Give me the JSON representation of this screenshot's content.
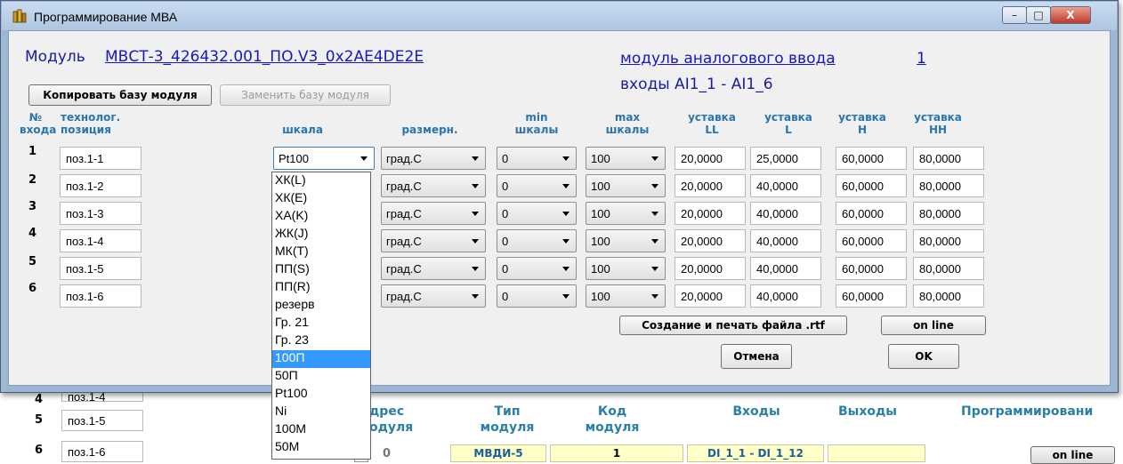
{
  "window": {
    "title": "Программирование МВА",
    "minimize": "–",
    "maximize": "□",
    "close": "X"
  },
  "module": {
    "prefix": "Модуль",
    "name_link": "МВСТ-3_426432.001_ПО.V3_0x2AE4DE2E",
    "type_link": "модуль аналогового ввода",
    "number_link": "1",
    "inputs_label": "входы AI1_1 - AI1_6"
  },
  "buttons": {
    "copy": "Копировать базу модуля",
    "replace": "Заменить базу модуля",
    "create_print": "Создание и печать файла .rtf",
    "online": "on line",
    "cancel": "Отмена",
    "ok": "OK"
  },
  "columns": {
    "num_1": "№",
    "num_2": "входа",
    "pos_1": "технолог.",
    "pos_2": "позиция",
    "scale": "шкала",
    "unit": "размерн.",
    "min_1": "min",
    "min_2": "шкалы",
    "max_1": "max",
    "max_2": "шкалы",
    "ll_1": "уставка",
    "ll_2": "LL",
    "l_1": "уставка",
    "l_2": "L",
    "h_1": "уставка",
    "h_2": "H",
    "hh_1": "уставка",
    "hh_2": "HH"
  },
  "rows": [
    {
      "num": "1",
      "pos": "поз.1-1",
      "scale": "Pt100",
      "unit": "град.С",
      "min": "0",
      "max": "100",
      "ll": "20,0000",
      "l": "25,0000",
      "h": "60,0000",
      "hh": "80,0000"
    },
    {
      "num": "2",
      "pos": "поз.1-2",
      "unit": "град.С",
      "min": "0",
      "max": "100",
      "ll": "20,0000",
      "l": "40,0000",
      "h": "60,0000",
      "hh": "80,0000"
    },
    {
      "num": "3",
      "pos": "поз.1-3",
      "unit": "град.С",
      "min": "0",
      "max": "100",
      "ll": "20,0000",
      "l": "40,0000",
      "h": "60,0000",
      "hh": "80,0000"
    },
    {
      "num": "4",
      "pos": "поз.1-4",
      "unit": "град.С",
      "min": "0",
      "max": "100",
      "ll": "20,0000",
      "l": "40,0000",
      "h": "60,0000",
      "hh": "80,0000"
    },
    {
      "num": "5",
      "pos": "поз.1-5",
      "unit": "град.С",
      "min": "0",
      "max": "100",
      "ll": "20,0000",
      "l": "40,0000",
      "h": "60,0000",
      "hh": "80,0000"
    },
    {
      "num": "6",
      "pos": "поз.1-6",
      "unit": "град.С",
      "min": "0",
      "max": "100",
      "ll": "20,0000",
      "l": "40,0000",
      "h": "60,0000",
      "hh": "80,0000"
    }
  ],
  "scale_options": [
    "ХК(L)",
    "ХК(E)",
    "ХА(K)",
    "ЖК(J)",
    "МК(T)",
    "ПП(S)",
    "ПП(R)",
    "резерв",
    "Гр. 21",
    "Гр. 23",
    "100П",
    "50П",
    "Pt100",
    "Ni",
    "100М",
    "50М"
  ],
  "scale_highlighted": "100П",
  "background": {
    "rows": [
      {
        "num": "4",
        "pos": "поз.1-4"
      },
      {
        "num": "5",
        "pos": "поз.1-5"
      },
      {
        "num": "6",
        "pos": "поз.1-6"
      }
    ],
    "headers": {
      "addr_1": "дрес",
      "addr_2": "одуля",
      "type_1": "Тип",
      "type_2": "модуля",
      "code_1": "Код",
      "code_2": "модуля",
      "inputs": "Входы",
      "outputs": "Выходы",
      "prog": "Программировани"
    },
    "data_row": {
      "addr": "0",
      "type": "МВДИ-5",
      "code": "1",
      "inputs": "DI_1_1 - DI_1_12",
      "outputs": ""
    },
    "online": "on line"
  }
}
